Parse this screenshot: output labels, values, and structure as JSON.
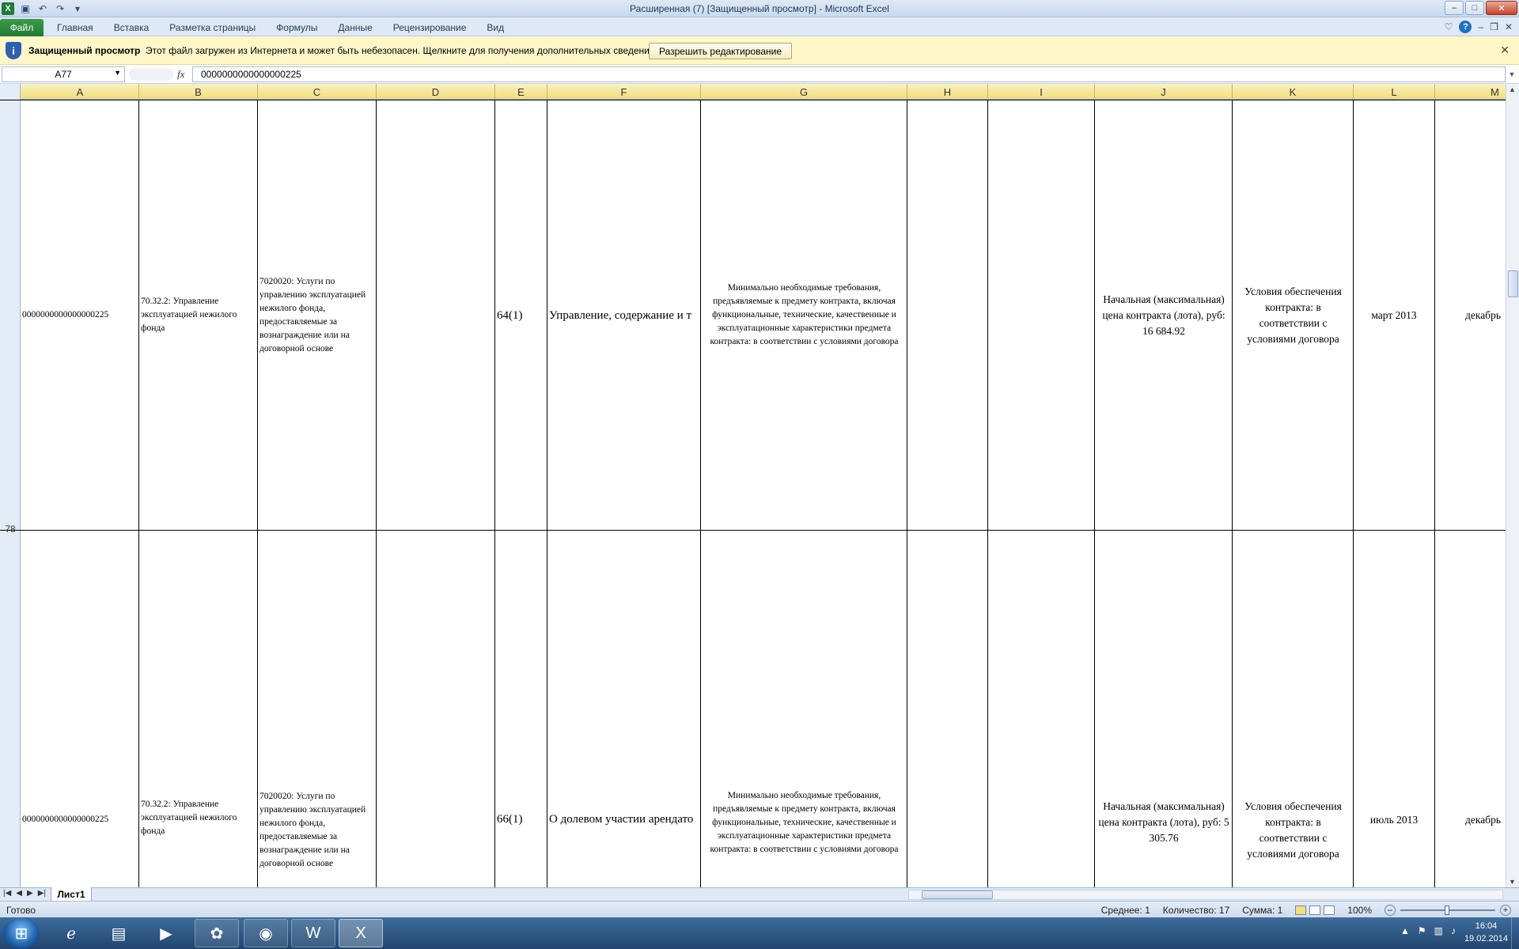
{
  "window": {
    "title": "Расширенная (7)  [Защищенный просмотр] - Microsoft Excel"
  },
  "ribbon": {
    "file_tab": "Файл",
    "tabs": [
      "Главная",
      "Вставка",
      "Разметка страницы",
      "Формулы",
      "Данные",
      "Рецензирование",
      "Вид"
    ]
  },
  "protected_view": {
    "title": "Защищенный просмотр",
    "message": "Этот файл загружен из Интернета и может быть небезопасен. Щелкните для получения дополнительных сведений.",
    "button": "Разрешить редактирование"
  },
  "formula_bar": {
    "name_box": "A77",
    "fx": "fx",
    "value": "0000000000000000225"
  },
  "columns": [
    "A",
    "B",
    "C",
    "D",
    "E",
    "F",
    "G",
    "H",
    "I",
    "J",
    "K",
    "L",
    "M"
  ],
  "row_labels": [
    "78"
  ],
  "rows": [
    {
      "a": "0000000000000000225",
      "b": "70.32.2:  Управление эксплуатацией нежилого фонда",
      "c": "7020020:  Услуги по управлению эксплуатацией нежилого фонда, предоставляемые за вознаграждение или на договорной основе",
      "e": "64(1)",
      "f": "Управление, содержание и т",
      "g": "Минимально необходимые требования, предъявляемые к предмету контракта, включая функциональные, технические, качественные и эксплуатационные характеристики предмета контракта: в соответствии с условиями договора",
      "j": "Начальная (максимальная) цена контракта (лота), руб: 16 684.92",
      "k": "Условия обеспечения контракта: в соответствии с условиями договора",
      "l": "март 2013",
      "m": "декабрь"
    },
    {
      "a": "0000000000000000225",
      "b": "70.32.2:  Управление эксплуатацией нежилого фонда",
      "c": "7020020:  Услуги по управлению эксплуатацией нежилого фонда, предоставляемые за вознаграждение или на договорной основе",
      "e": "66(1)",
      "f": "О долевом участии арендато",
      "g": "Минимально необходимые требования, предъявляемые к предмету контракта, включая функциональные, технические, качественные и эксплуатационные характеристики предмета контракта: в соответствии с условиями договора",
      "j": "Начальная (максимальная) цена контракта (лота), руб: 5 305.76",
      "k": "Условия обеспечения контракта: в соответствии с условиями договора",
      "l": "июль 2013",
      "m": "декабрь"
    }
  ],
  "sheet_tab": "Лист1",
  "status": {
    "ready": "Готово",
    "average": "Среднее: 1",
    "count": "Количество: 17",
    "sum": "Сумма: 1",
    "zoom": "100%"
  },
  "clock": {
    "time": "16:04",
    "date": "19.02.2014"
  }
}
